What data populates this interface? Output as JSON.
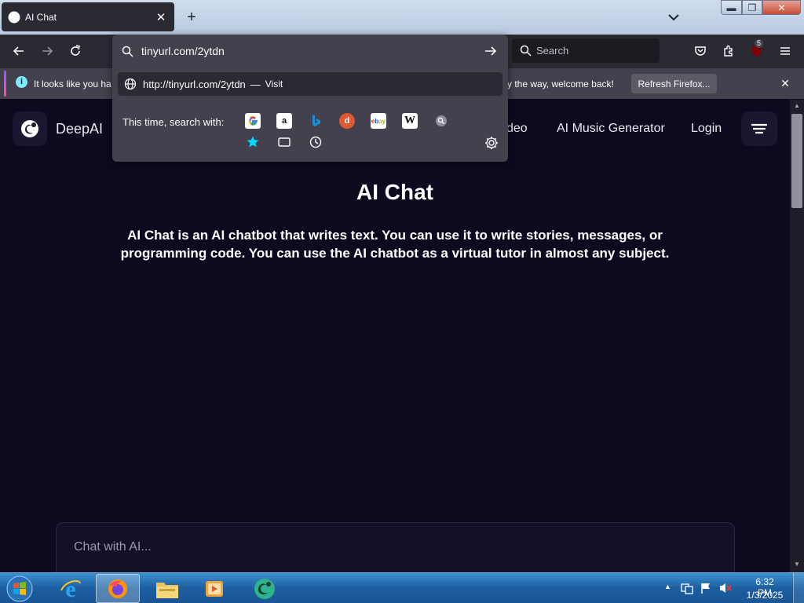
{
  "browser": {
    "tab_title": "AI Chat",
    "new_tab_label": "+",
    "window_controls": {
      "minimize": "▬",
      "maximize": "❐",
      "close": "✕"
    },
    "search_placeholder": "Search",
    "extensions_badge": "5"
  },
  "url_dropdown": {
    "url_value": "tinyurl.com/2ytdn",
    "suggestion_url": "http://tinyurl.com/2ytdn",
    "suggestion_separator": "—",
    "suggestion_action": "Visit",
    "search_with_label": "This time, search with:",
    "engines": [
      "google-icon",
      "amazon-icon",
      "bing-icon",
      "duckduckgo-icon",
      "ebay-icon",
      "wikipedia-icon",
      "search-engine-icon"
    ],
    "modes": [
      "bookmarks-icon",
      "tabs-icon",
      "history-icon"
    ]
  },
  "notification": {
    "text_left": "It looks like you ha",
    "text_right": "y the way, welcome back!",
    "refresh_label": "Refresh Firefox...",
    "close_label": "✕"
  },
  "site": {
    "logo_text": "DeepAI",
    "nav_partial": "deo",
    "nav_music": "AI Music Generator",
    "nav_login": "Login",
    "title": "AI Chat",
    "description": "AI Chat is an AI chatbot that writes text. You can use it to write stories, messages, or programming code. You can use the AI chatbot as a virtual tutor in almost any subject.",
    "chat_placeholder": "Chat with AI..."
  },
  "taskbar": {
    "time": "6:32 PM",
    "date": "1/3/2025",
    "apps": [
      "internet-explorer-icon",
      "firefox-icon",
      "file-explorer-icon",
      "media-player-icon",
      "deepai-app-icon"
    ]
  },
  "colors": {
    "page_bg": "#0c0a1e",
    "browser_chrome": "#2b2a33",
    "dropdown_bg": "#42414d",
    "taskbar": "#1c5fa0"
  }
}
